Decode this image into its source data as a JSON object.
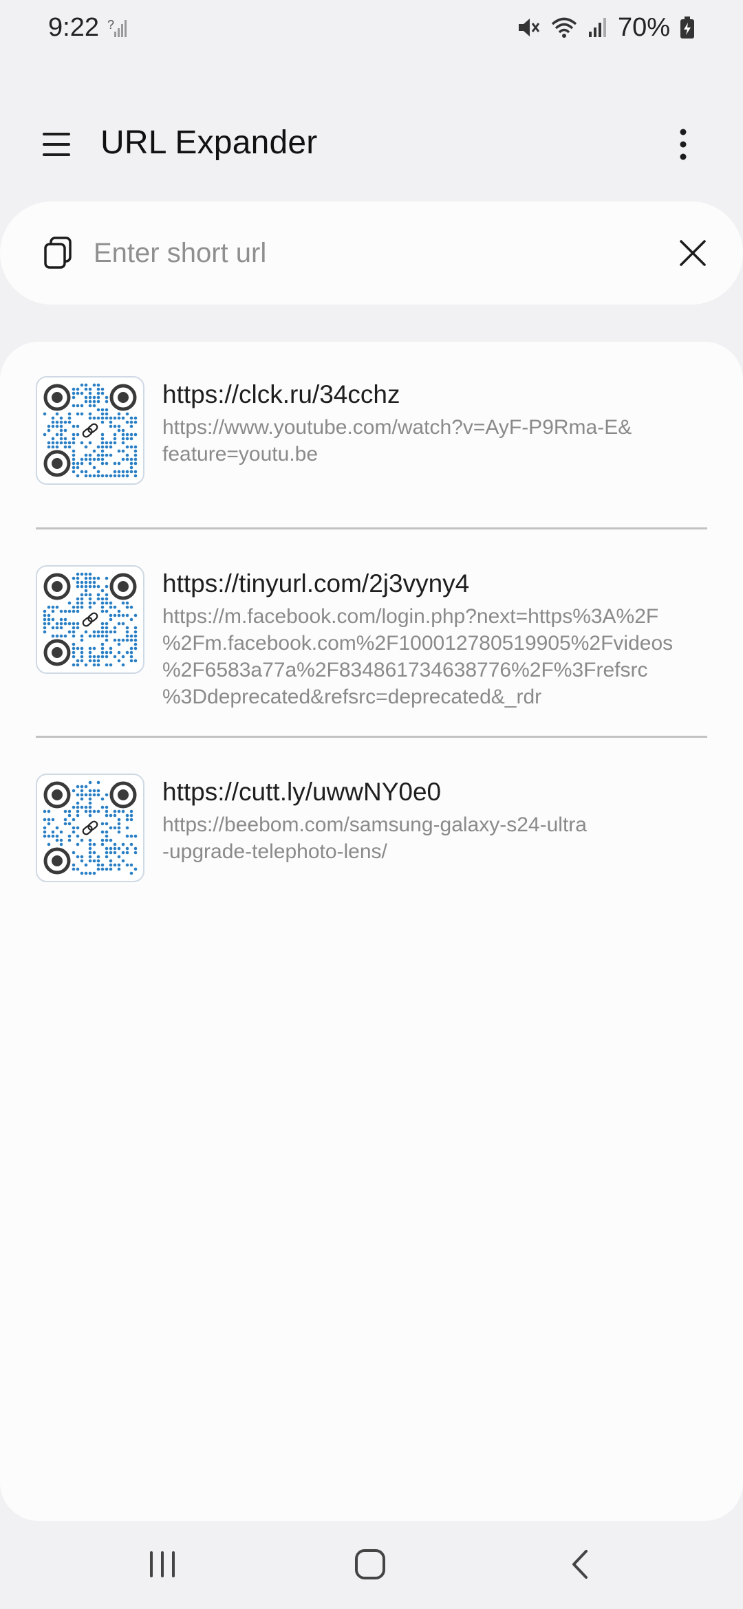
{
  "status_bar": {
    "time": "9:22",
    "battery_percent": "70%",
    "icons": [
      "signal-no-sim-icon",
      "mute-icon",
      "wifi-icon",
      "signal-icon",
      "battery-charging-icon"
    ]
  },
  "app_bar": {
    "title": "URL Expander",
    "menu_icon": "hamburger-menu-icon",
    "more_icon": "more-vert-icon"
  },
  "search": {
    "placeholder": "Enter short url",
    "value": "",
    "paste_icon": "paste-icon",
    "clear_icon": "close-icon"
  },
  "history": [
    {
      "short_url": "https://clck.ru/34cchz",
      "long_url_lines": [
        "https://www.youtube.com/watch?v=AyF-P9Rma-E&",
        "feature=youtu.be"
      ]
    },
    {
      "short_url": "https://tinyurl.com/2j3vyny4",
      "long_url_lines": [
        "https://m.facebook.com/login.php?next=https%3A%2F",
        "%2Fm.facebook.com%2F100012780519905%2Fvideos",
        "%2F6583a77a%2F834861734638776%2F%3Frefsrc",
        "%3Ddeprecated&refsrc=deprecated&_rdr"
      ]
    },
    {
      "short_url": "https://cutt.ly/uwwNY0e0",
      "long_url_lines": [
        "https://beebom.com/samsung-galaxy-s24-ultra",
        "-upgrade-telephoto-lens/"
      ]
    }
  ],
  "colors": {
    "background": "#f1f1f3",
    "card": "#fcfcfc",
    "qr_dots": "#2a7fc4",
    "secondary_text": "#8a8a8a"
  },
  "nav_bar": {
    "icons": [
      "recent-apps-icon",
      "home-icon",
      "back-icon"
    ]
  }
}
